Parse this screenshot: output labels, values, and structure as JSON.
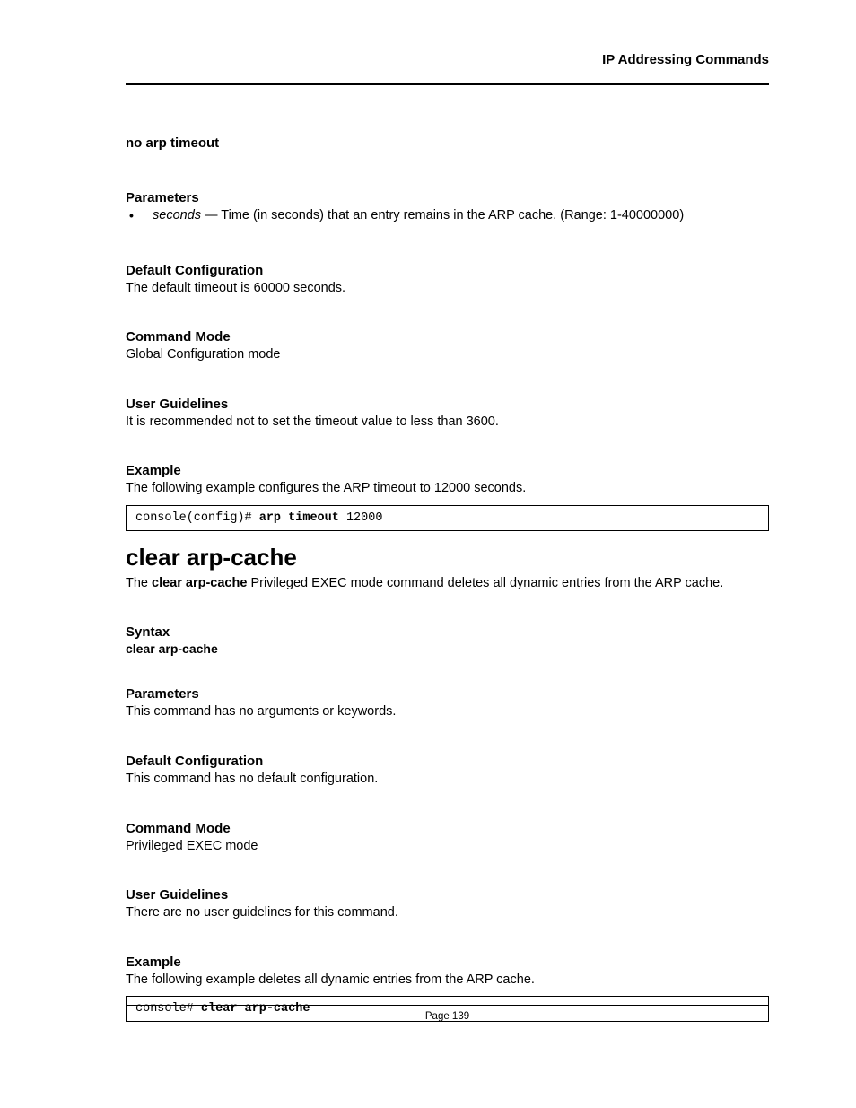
{
  "header": {
    "title": "IP Addressing Commands"
  },
  "sec_no_arp": {
    "heading": "no arp timeout"
  },
  "sec_params1": {
    "heading": "Parameters",
    "bullet_term": "seconds",
    "bullet_rest": " — Time (in seconds) that an entry remains in the ARP cache. (Range: 1-40000000)"
  },
  "sec_defcfg1": {
    "heading": "Default Configuration",
    "text": "The default timeout is 60000 seconds."
  },
  "sec_mode1": {
    "heading": "Command Mode",
    "text": "Global Configuration mode"
  },
  "sec_guide1": {
    "heading": "User Guidelines",
    "text": "It is recommended not to set the timeout value to less than 3600."
  },
  "sec_example1": {
    "heading": "Example",
    "text": "The following example configures the ARP timeout to 12000 seconds.",
    "code_prefix": "console(config)# ",
    "code_bold": "arp timeout ",
    "code_suffix": "12000"
  },
  "cmd2": {
    "title": "clear arp-cache",
    "desc_pre": "The ",
    "desc_bold": "clear arp-cache",
    "desc_post": " Privileged EXEC mode command deletes all dynamic entries from the ARP cache."
  },
  "sec_syntax2": {
    "heading": "Syntax",
    "line": "clear arp-cache"
  },
  "sec_params2": {
    "heading": "Parameters",
    "text": "This command has no arguments or keywords."
  },
  "sec_defcfg2": {
    "heading": "Default Configuration",
    "text": "This command has no default configuration."
  },
  "sec_mode2": {
    "heading": "Command Mode",
    "text": "Privileged EXEC mode"
  },
  "sec_guide2": {
    "heading": "User Guidelines",
    "text": "There are no user guidelines for this command."
  },
  "sec_example2": {
    "heading": "Example",
    "text": "The following example deletes all dynamic entries from the ARP cache.",
    "code_prefix": "console# ",
    "code_bold": "clear arp-cache"
  },
  "footer": {
    "text": "Page 139"
  }
}
